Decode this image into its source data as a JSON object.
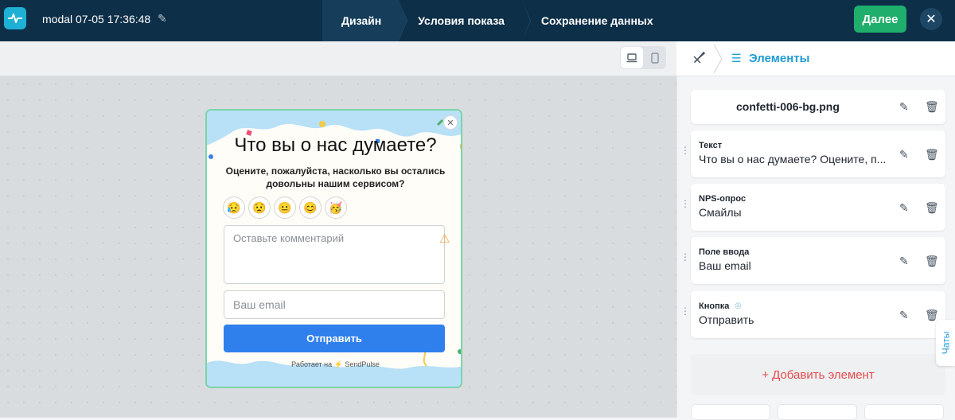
{
  "topbar": {
    "doc_title": "modal 07-05 17:36:48",
    "steps": [
      "Дизайн",
      "Условия показа",
      "Сохранение данных"
    ],
    "next_label": "Далее"
  },
  "modal": {
    "title": "Что вы о нас думаете?",
    "subtitle": "Оцените, пожалуйста, насколько вы остались довольны нашим сервисом?",
    "smiles": [
      "😥",
      "😟",
      "😐",
      "😊",
      "🥳"
    ],
    "comment_placeholder": "Оставьте комментарий",
    "email_placeholder": "Ваш email",
    "submit_label": "Отправить",
    "powered_by": "Работает на ⚡ SendPulse"
  },
  "panel": {
    "tab_label": "Элементы",
    "items": [
      {
        "type": "",
        "value": "confetti-006-bg.png"
      },
      {
        "type": "Текст",
        "value": "Что вы о нас думаете? Оцените, п..."
      },
      {
        "type": "NPS-опрос",
        "value": "Смайлы"
      },
      {
        "type": "Поле ввода",
        "value": "Ваш email"
      },
      {
        "type": "Кнопка",
        "value": "Отправить"
      }
    ],
    "add_label": "+ Добавить элемент",
    "chats_label": "Чаты"
  },
  "colors": {
    "topbar": "#0d2f48",
    "next_button": "#1fae6b",
    "accent": "#1f9bd7",
    "submit": "#2f80ed",
    "add": "#e84b4b"
  }
}
